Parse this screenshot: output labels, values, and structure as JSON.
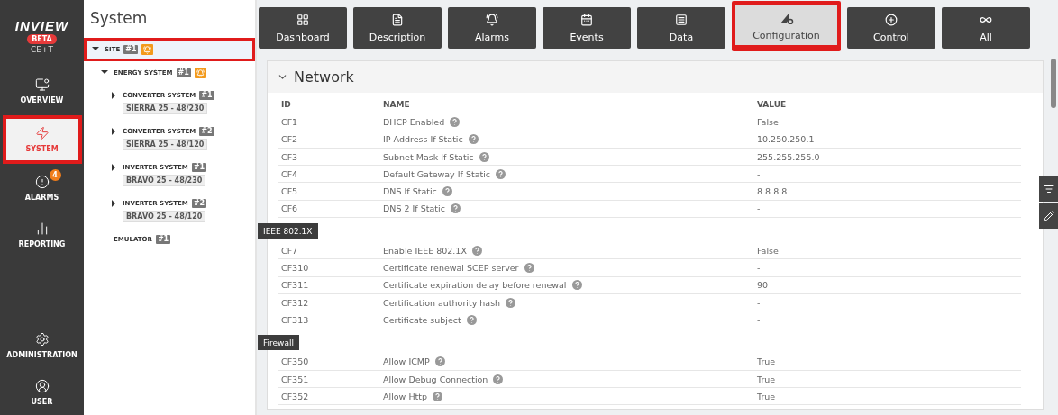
{
  "sidebar": {
    "logo": "INVIEW",
    "beta": "BETA",
    "org": "CE+T",
    "nav": [
      {
        "kind": "overview",
        "label": "OVERVIEW",
        "selected": false,
        "highlighted": false
      },
      {
        "kind": "system",
        "label": "SYSTEM",
        "selected": true,
        "highlighted": true
      },
      {
        "kind": "alarms",
        "label": "ALARMS",
        "selected": false,
        "highlighted": false,
        "badge": "4"
      },
      {
        "kind": "reporting",
        "label": "REPORTING",
        "selected": false,
        "highlighted": false
      }
    ],
    "bottom": [
      {
        "kind": "administration",
        "label": "ADMINISTRATION",
        "selected": false,
        "highlighted": false
      },
      {
        "kind": "user",
        "label": "USER",
        "selected": false,
        "highlighted": false
      }
    ]
  },
  "tree": {
    "title": "System",
    "nodes": [
      {
        "label": "SITE",
        "tag": "#1",
        "alarm": true,
        "expanded": true,
        "selected": true,
        "highlighted": true,
        "children": [
          {
            "label": "ENERGY SYSTEM",
            "tag": "#1",
            "alarm": true,
            "expanded": true,
            "selected": false,
            "highlighted": false,
            "children": [
              {
                "label": "CONVERTER SYSTEM",
                "tag": "#1",
                "model": "SIERRA 25 - 48/230",
                "alarm": false,
                "expanded": false,
                "selected": false,
                "highlighted": false
              },
              {
                "label": "CONVERTER SYSTEM",
                "tag": "#2",
                "model": "SIERRA 25 - 48/120",
                "alarm": false,
                "expanded": false,
                "selected": false,
                "highlighted": false
              },
              {
                "label": "INVERTER SYSTEM",
                "tag": "#1",
                "model": "BRAVO 25 - 48/230",
                "alarm": false,
                "expanded": false,
                "selected": false,
                "highlighted": false
              },
              {
                "label": "INVERTER SYSTEM",
                "tag": "#2",
                "model": "BRAVO 25 - 48/120",
                "alarm": false,
                "expanded": false,
                "selected": false,
                "highlighted": false
              }
            ]
          },
          {
            "label": "EMULATOR",
            "tag": "#1",
            "alarm": false,
            "selected": false,
            "highlighted": false
          }
        ]
      }
    ]
  },
  "tabs": [
    {
      "kind": "dashboard",
      "label": "Dashboard",
      "selected": false,
      "highlighted": false
    },
    {
      "kind": "description",
      "label": "Description",
      "selected": false,
      "highlighted": false
    },
    {
      "kind": "alarms",
      "label": "Alarms",
      "selected": false,
      "highlighted": false
    },
    {
      "kind": "events",
      "label": "Events",
      "selected": false,
      "highlighted": false
    },
    {
      "kind": "data",
      "label": "Data",
      "selected": false,
      "highlighted": false
    },
    {
      "kind": "configuration",
      "label": "Configuration",
      "selected": true,
      "highlighted": true
    },
    {
      "kind": "control",
      "label": "Control",
      "selected": false,
      "highlighted": false
    },
    {
      "kind": "all",
      "label": "All",
      "selected": false,
      "highlighted": false
    }
  ],
  "section": {
    "title": "Network",
    "expanded": true,
    "columns": [
      "ID",
      "NAME",
      "VALUE"
    ],
    "groups": [
      {
        "rows": [
          {
            "id": "CF1",
            "name": "DHCP Enabled",
            "value": "False"
          },
          {
            "id": "CF2",
            "name": "IP Address If Static",
            "value": "10.250.250.1"
          },
          {
            "id": "CF3",
            "name": "Subnet Mask If Static",
            "value": "255.255.255.0"
          },
          {
            "id": "CF4",
            "name": "Default Gateway If Static",
            "value": "-"
          },
          {
            "id": "CF5",
            "name": "DNS If Static",
            "value": "8.8.8.8"
          },
          {
            "id": "CF6",
            "name": "DNS 2 If Static",
            "value": "-"
          }
        ]
      },
      {
        "label": "IEEE 802.1X",
        "rows": [
          {
            "id": "CF7",
            "name": "Enable IEEE 802.1X",
            "value": "False"
          },
          {
            "id": "CF310",
            "name": "Certificate renewal SCEP server",
            "value": "-"
          },
          {
            "id": "CF311",
            "name": "Certificate expiration delay before renewal",
            "value": "90"
          },
          {
            "id": "CF312",
            "name": "Certification authority hash",
            "value": "-"
          },
          {
            "id": "CF313",
            "name": "Certificate subject",
            "value": "-"
          }
        ]
      },
      {
        "label": "Firewall",
        "rows": [
          {
            "id": "CF350",
            "name": "Allow ICMP",
            "value": "True"
          },
          {
            "id": "CF351",
            "name": "Allow Debug Connection",
            "value": "True"
          },
          {
            "id": "CF352",
            "name": "Allow Http",
            "value": "True"
          }
        ]
      }
    ]
  }
}
